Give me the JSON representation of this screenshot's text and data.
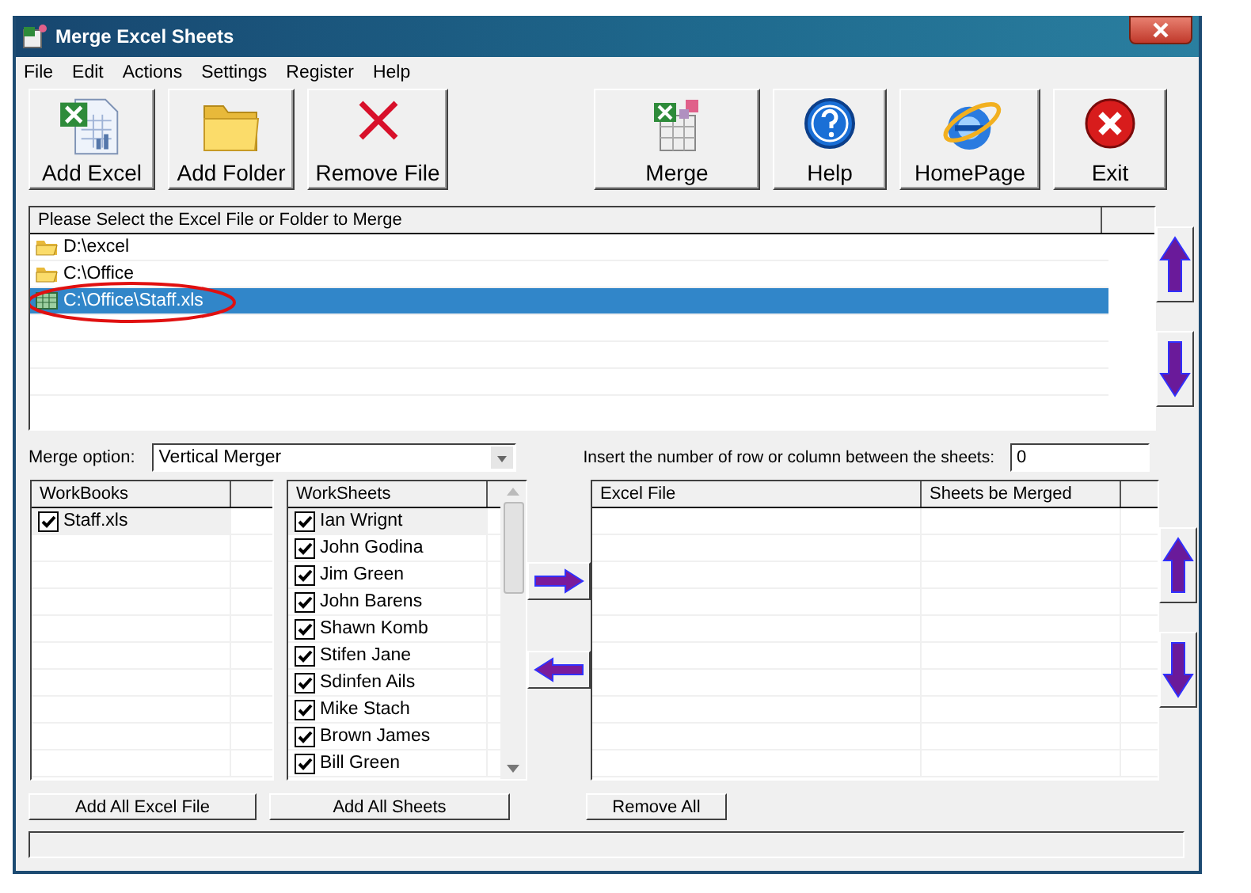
{
  "window": {
    "title": "Merge Excel Sheets"
  },
  "menu": [
    "File",
    "Edit",
    "Actions",
    "Settings",
    "Register",
    "Help"
  ],
  "toolbar": [
    {
      "label": "Add Excel",
      "kind": "excel"
    },
    {
      "label": "Add Folder",
      "kind": "folder"
    },
    {
      "label": "Remove File",
      "kind": "remove"
    },
    {
      "label": "Merge",
      "kind": "merge"
    },
    {
      "label": "Help",
      "kind": "help"
    },
    {
      "label": "HomePage",
      "kind": "home"
    },
    {
      "label": "Exit",
      "kind": "exit"
    }
  ],
  "file_list": {
    "header": "Please Select the Excel File or Folder to Merge",
    "items": [
      {
        "path": "D:\\excel",
        "kind": "folder",
        "selected": false,
        "circled": false
      },
      {
        "path": "C:\\Office",
        "kind": "folder",
        "selected": false,
        "circled": false
      },
      {
        "path": "C:\\Office\\Staff.xls",
        "kind": "file",
        "selected": true,
        "circled": true
      }
    ]
  },
  "merge_option": {
    "label": "Merge option:",
    "value": "Vertical Merger"
  },
  "spacing": {
    "label": "Insert the number of row or column between the sheets:",
    "value": "0"
  },
  "workbooks": {
    "header": "WorkBooks",
    "rows": [
      {
        "name": "Staff.xls",
        "checked": true,
        "selected": true
      }
    ]
  },
  "worksheets": {
    "header": "WorkSheets",
    "rows": [
      {
        "name": "Ian Wrignt",
        "checked": true,
        "selected": true
      },
      {
        "name": "John Godina",
        "checked": true,
        "selected": false
      },
      {
        "name": "Jim Green",
        "checked": true,
        "selected": false
      },
      {
        "name": "John Barens",
        "checked": true,
        "selected": false
      },
      {
        "name": "Shawn Komb",
        "checked": true,
        "selected": false
      },
      {
        "name": "Stifen Jane",
        "checked": true,
        "selected": false
      },
      {
        "name": "Sdinfen Ails",
        "checked": true,
        "selected": false
      },
      {
        "name": "Mike Stach",
        "checked": true,
        "selected": false
      },
      {
        "name": "Brown James",
        "checked": true,
        "selected": false
      },
      {
        "name": "Bill Green",
        "checked": true,
        "selected": false
      }
    ]
  },
  "merged": {
    "columns": [
      "Excel File",
      "Sheets be Merged"
    ]
  },
  "bottom_buttons": [
    "Add All Excel File",
    "Add All Sheets",
    "Remove All"
  ]
}
